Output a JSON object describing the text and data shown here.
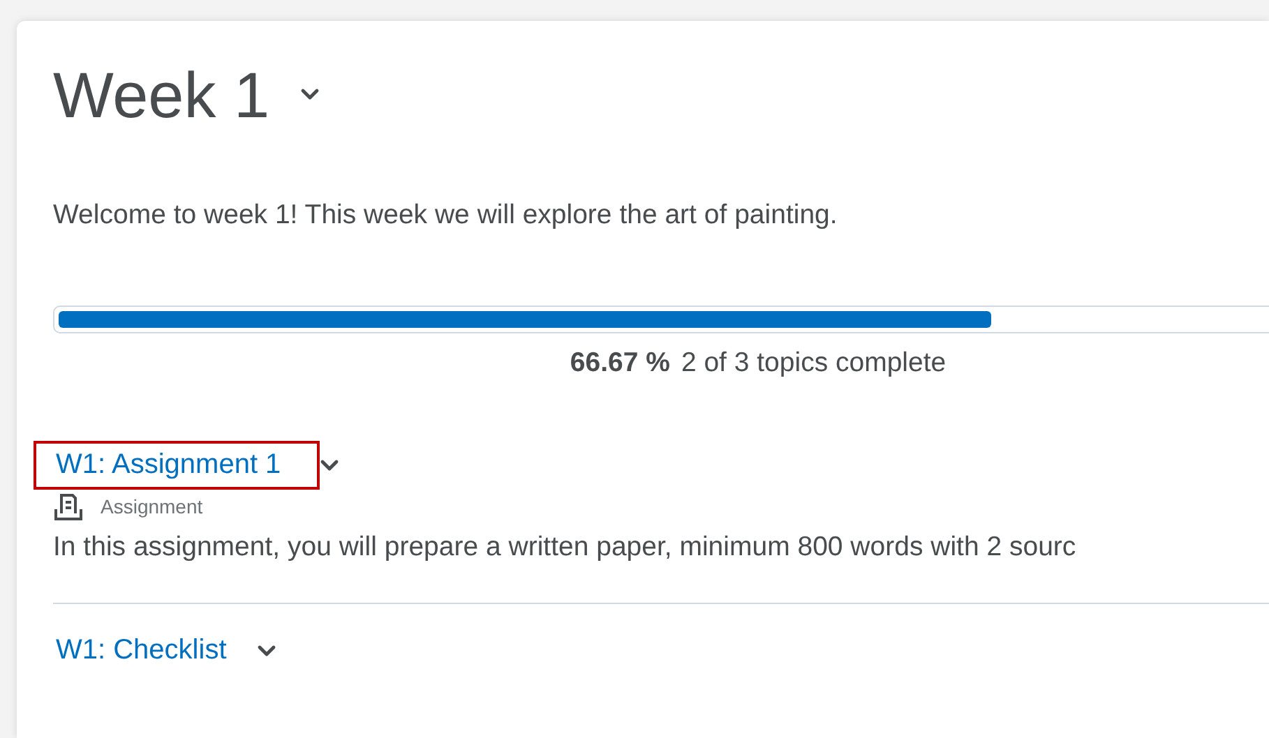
{
  "module": {
    "title": "Week 1",
    "description": "Welcome to week 1! This week we will explore the art of painting.",
    "progress": {
      "level": 0.6667,
      "percent": "66.67 %",
      "summary": "2 of 3 topics complete"
    },
    "items": [
      {
        "kind": "assignment",
        "title": "W1: Assignment 1",
        "highlighted": true,
        "type_label": "Assignment",
        "description": "In this assignment, you will prepare a written paper, minimum 800 words with 2 sourc"
      },
      {
        "kind": "checklist",
        "title": "W1: Checklist",
        "highlighted": false
      }
    ]
  }
}
